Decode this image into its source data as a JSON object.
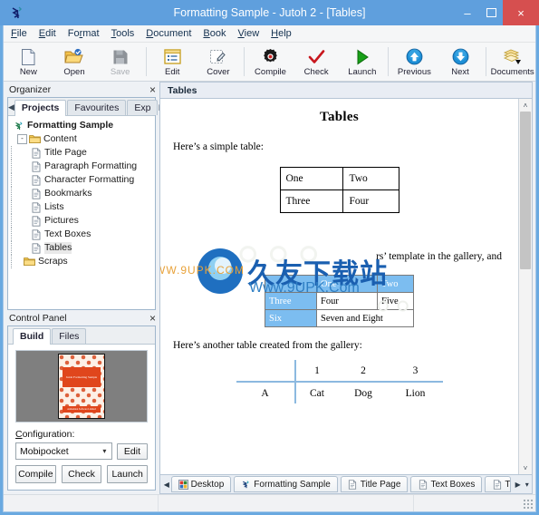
{
  "window": {
    "title": "Formatting Sample - Jutoh 2 - [Tables]",
    "app_icon": "jutoh-logo-icon",
    "minimize": "–",
    "maximize": "□",
    "close": "×",
    "accent": "#6aa9e0",
    "close_color": "#d64f4f"
  },
  "menubar": {
    "items": [
      {
        "label": "File",
        "accel": "F"
      },
      {
        "label": "Edit",
        "accel": "E"
      },
      {
        "label": "Format",
        "accel": "r"
      },
      {
        "label": "Tools",
        "accel": "T"
      },
      {
        "label": "Document",
        "accel": "D"
      },
      {
        "label": "Book",
        "accel": "B"
      },
      {
        "label": "View",
        "accel": "V"
      },
      {
        "label": "Help",
        "accel": "H"
      }
    ]
  },
  "toolbar": {
    "buttons": [
      {
        "label": "New",
        "icon": "new-document-icon",
        "disabled": false
      },
      {
        "label": "Open",
        "icon": "open-folder-icon",
        "disabled": false
      },
      {
        "label": "Save",
        "icon": "save-disk-icon",
        "disabled": true
      },
      {
        "label": "Edit",
        "icon": "edit-window-icon",
        "disabled": false
      },
      {
        "label": "Cover",
        "icon": "cover-design-icon",
        "disabled": false
      },
      {
        "label": "Compile",
        "icon": "compile-gear-icon",
        "disabled": false
      },
      {
        "label": "Check",
        "icon": "check-tick-icon",
        "disabled": false
      },
      {
        "label": "Launch",
        "icon": "launch-play-icon",
        "disabled": false
      },
      {
        "label": "Previous",
        "icon": "previous-up-arrow-icon",
        "disabled": false
      },
      {
        "label": "Next",
        "icon": "next-down-arrow-icon",
        "disabled": false
      },
      {
        "label": "Documents",
        "icon": "documents-stack-icon",
        "disabled": false
      }
    ]
  },
  "organizer": {
    "title": "Organizer",
    "close": "×",
    "left_arrow": "◀",
    "right_arrow": "▶",
    "tabs": [
      {
        "label": "Projects",
        "active": true
      },
      {
        "label": "Favourites",
        "active": false
      },
      {
        "label": "Exp",
        "active": false
      }
    ],
    "tree": [
      {
        "label": "Formatting Sample",
        "level": 0,
        "icon": "jutoh-project-icon",
        "bold": true,
        "expander": ""
      },
      {
        "label": "Content",
        "level": 1,
        "icon": "folder-icon",
        "bold": false,
        "expander": "-"
      },
      {
        "label": "Title Page",
        "level": 2,
        "icon": "document-icon",
        "bold": false,
        "expander": ""
      },
      {
        "label": "Paragraph Formatting",
        "level": 2,
        "icon": "document-icon",
        "bold": false,
        "expander": ""
      },
      {
        "label": "Character Formatting",
        "level": 2,
        "icon": "document-icon",
        "bold": false,
        "expander": ""
      },
      {
        "label": "Bookmarks",
        "level": 2,
        "icon": "document-icon",
        "bold": false,
        "expander": ""
      },
      {
        "label": "Lists",
        "level": 2,
        "icon": "document-icon",
        "bold": false,
        "expander": ""
      },
      {
        "label": "Pictures",
        "level": 2,
        "icon": "document-icon",
        "bold": false,
        "expander": ""
      },
      {
        "label": "Text Boxes",
        "level": 2,
        "icon": "document-icon",
        "bold": false,
        "expander": ""
      },
      {
        "label": "Tables",
        "level": 2,
        "icon": "document-icon",
        "bold": false,
        "expander": "",
        "selected": true
      },
      {
        "label": "Scraps",
        "level": 1,
        "icon": "folder-icon",
        "bold": false,
        "expander": ""
      }
    ]
  },
  "control_panel": {
    "title": "Control Panel",
    "close": "×",
    "tabs": [
      {
        "label": "Build",
        "active": true
      },
      {
        "label": "Files",
        "active": false
      }
    ],
    "cover": {
      "title": "Jutoh Formatting Sample",
      "footer": "Anthemion Software Limited"
    },
    "configuration_label": "Configuration:",
    "configuration_accel": "C",
    "configuration_value": "Mobipocket",
    "configuration_options": [
      "Mobipocket"
    ],
    "edit_button": "Edit",
    "buttons": [
      "Compile",
      "Check",
      "Launch"
    ]
  },
  "document": {
    "header": "Tables",
    "title": "Tables",
    "intro": "Here’s a simple table:",
    "simple_table": {
      "rows": [
        [
          "One",
          "Two"
        ],
        [
          "Three",
          "Four"
        ]
      ]
    },
    "paragraph2": "rs’ template in the gallery, and",
    "blue_table": {
      "rows": [
        [
          "",
          "One",
          "Two"
        ],
        [
          "Three",
          "Four",
          "Five"
        ],
        [
          "Six",
          "Seven and Eight"
        ]
      ],
      "header_color": "#7cbdf0"
    },
    "intro2": "Here’s another table created from the gallery:",
    "gallery_table": {
      "header": [
        "",
        "1",
        "2",
        "3"
      ],
      "rows": [
        [
          "A",
          "Cat",
          "Dog",
          "Lion"
        ]
      ],
      "rule_color": "#8cb9e0"
    },
    "watermark": {
      "chinese": "久友下载站",
      "url": "Www.9UPK.Com",
      "left_text": "WW.9UPK.COM"
    },
    "scroll": {
      "up": "˄",
      "down": "˅"
    }
  },
  "doc_tabs": {
    "left_arrow": "◀",
    "right_arrow": "▶",
    "more": "▾",
    "items": [
      {
        "label": "Desktop",
        "icon": "desktop-icon"
      },
      {
        "label": "Formatting Sample",
        "icon": "jutoh-project-icon"
      },
      {
        "label": "Title Page",
        "icon": "document-icon"
      },
      {
        "label": "Text Boxes",
        "icon": "document-icon"
      },
      {
        "label": "T",
        "icon": "document-icon"
      }
    ]
  },
  "statusbar": {
    "fields": [
      "",
      "",
      ""
    ],
    "grip": "resize-grip-icon"
  }
}
